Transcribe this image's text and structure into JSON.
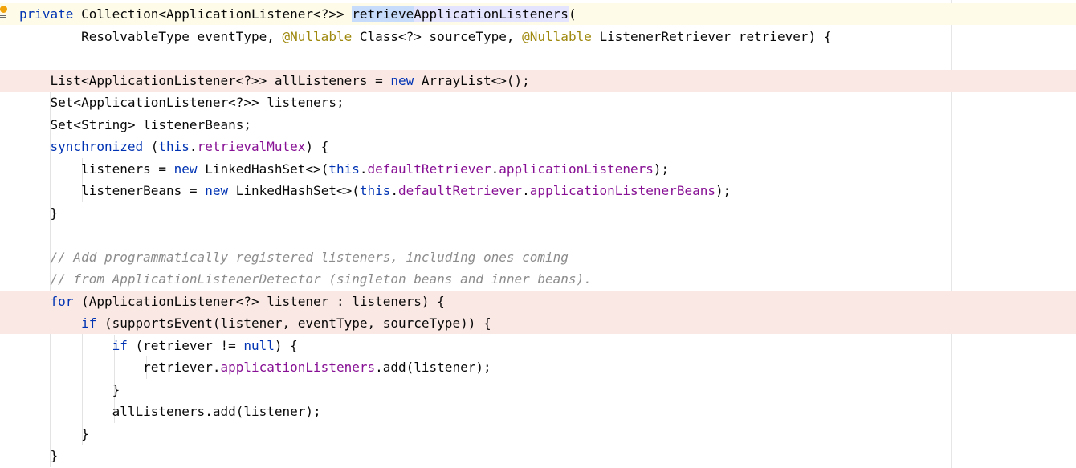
{
  "editor": {
    "language": "java",
    "selected_identifier": "retrieve",
    "icons": {
      "intention": "intention-bulb-icon"
    },
    "colors": {
      "keyword": "#0033b3",
      "field": "#871094",
      "annotation": "#9e880d",
      "comment": "#8c8c8c",
      "text": "#080808",
      "selection": "#c6dcfa",
      "caret_row": "#fefce8",
      "highlighted_row": "#f9e8e4"
    },
    "lines": [
      {
        "t": [
          {
            "k": "kw",
            "v": "private"
          },
          {
            "v": " Collection<ApplicationListener<?>> "
          },
          {
            "k": "sel",
            "v": "retrieve"
          },
          {
            "k": "occ",
            "v": "ApplicationListeners"
          },
          {
            "v": "("
          }
        ]
      },
      {
        "t": [
          {
            "v": "        ResolvableType eventType, "
          },
          {
            "k": "ann",
            "v": "@Nullable"
          },
          {
            "v": " Class<?> sourceType, "
          },
          {
            "k": "ann",
            "v": "@Nullable"
          },
          {
            "v": " ListenerRetriever retriever) {"
          }
        ]
      },
      {
        "t": []
      },
      {
        "t": [
          {
            "v": "    List<ApplicationListener<?>> allListeners = "
          },
          {
            "k": "kw",
            "v": "new"
          },
          {
            "v": " ArrayList<>();"
          }
        ]
      },
      {
        "t": [
          {
            "v": "    Set<ApplicationListener<?>> listeners;"
          }
        ]
      },
      {
        "t": [
          {
            "v": "    Set<String> listenerBeans;"
          }
        ]
      },
      {
        "t": [
          {
            "v": "    "
          },
          {
            "k": "kw",
            "v": "synchronized"
          },
          {
            "v": " ("
          },
          {
            "k": "kw",
            "v": "this"
          },
          {
            "v": "."
          },
          {
            "k": "fld",
            "v": "retrievalMutex"
          },
          {
            "v": ") {"
          }
        ]
      },
      {
        "t": [
          {
            "v": "        listeners = "
          },
          {
            "k": "kw",
            "v": "new"
          },
          {
            "v": " LinkedHashSet<>("
          },
          {
            "k": "kw",
            "v": "this"
          },
          {
            "v": "."
          },
          {
            "k": "fld",
            "v": "defaultRetriever"
          },
          {
            "v": "."
          },
          {
            "k": "fld",
            "v": "applicationListeners"
          },
          {
            "v": ");"
          }
        ]
      },
      {
        "t": [
          {
            "v": "        listenerBeans = "
          },
          {
            "k": "kw",
            "v": "new"
          },
          {
            "v": " LinkedHashSet<>("
          },
          {
            "k": "kw",
            "v": "this"
          },
          {
            "v": "."
          },
          {
            "k": "fld",
            "v": "defaultRetriever"
          },
          {
            "v": "."
          },
          {
            "k": "fld",
            "v": "applicationListenerBeans"
          },
          {
            "v": ");"
          }
        ]
      },
      {
        "t": [
          {
            "v": "    }"
          }
        ]
      },
      {
        "t": []
      },
      {
        "t": [
          {
            "v": "    "
          },
          {
            "k": "cmt",
            "v": "// Add programmatically registered listeners, including ones coming"
          }
        ]
      },
      {
        "t": [
          {
            "v": "    "
          },
          {
            "k": "cmt",
            "v": "// from ApplicationListenerDetector (singleton beans and inner beans)."
          }
        ]
      },
      {
        "t": [
          {
            "v": "    "
          },
          {
            "k": "kw",
            "v": "for"
          },
          {
            "v": " (ApplicationListener<?> listener : listeners) {"
          }
        ]
      },
      {
        "t": [
          {
            "v": "        "
          },
          {
            "k": "kw",
            "v": "if"
          },
          {
            "v": " (supportsEvent(listener, eventType, sourceType)) {"
          }
        ]
      },
      {
        "t": [
          {
            "v": "            "
          },
          {
            "k": "kw",
            "v": "if"
          },
          {
            "v": " (retriever != "
          },
          {
            "k": "kw",
            "v": "null"
          },
          {
            "v": ") {"
          }
        ]
      },
      {
        "t": [
          {
            "v": "                retriever."
          },
          {
            "k": "fld",
            "v": "applicationListeners"
          },
          {
            "v": ".add(listener);"
          }
        ]
      },
      {
        "t": [
          {
            "v": "            }"
          }
        ]
      },
      {
        "t": [
          {
            "v": "            allListeners.add(listener);"
          }
        ]
      },
      {
        "t": [
          {
            "v": "        }"
          }
        ]
      },
      {
        "t": [
          {
            "v": "    }"
          }
        ]
      }
    ]
  }
}
